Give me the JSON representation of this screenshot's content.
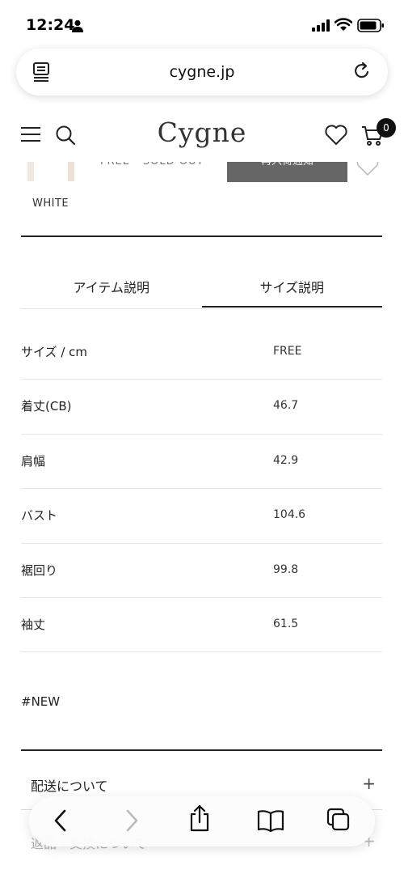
{
  "status_bar": {
    "time": "12:24"
  },
  "browser": {
    "url": "cygne.jp"
  },
  "site_header": {
    "logo": "Cygne",
    "cart_count": "0"
  },
  "product_row": {
    "size_text": "FREE - SOLD OUT",
    "notify_button": "再入荷通知",
    "color": "WHITE"
  },
  "tabs": [
    {
      "label": "アイテム説明"
    },
    {
      "label": "サイズ説明"
    }
  ],
  "size_table": {
    "rows": [
      {
        "key": "サイズ / cm",
        "value": "FREE"
      },
      {
        "key": "着丈(CB)",
        "value": "46.7"
      },
      {
        "key": "肩幅",
        "value": "42.9"
      },
      {
        "key": "バスト",
        "value": "104.6"
      },
      {
        "key": "裾回り",
        "value": "99.8"
      },
      {
        "key": "袖丈",
        "value": "61.5"
      }
    ]
  },
  "hashtag": "#NEW",
  "accordions": [
    {
      "label": "配送について",
      "icon": "plus-icon"
    },
    {
      "label": "返品・交換について",
      "icon": "plus-icon"
    }
  ],
  "icons": {
    "status": [
      "person-icon",
      "signal-icon",
      "wifi-icon",
      "battery-icon"
    ],
    "url_bar": [
      "reader-icon",
      "reload-icon"
    ],
    "header": [
      "menu-icon",
      "search-icon",
      "heart-icon",
      "cart-icon"
    ],
    "toolbar": [
      "back-icon",
      "forward-icon",
      "share-icon",
      "bookmarks-icon",
      "tabs-icon"
    ]
  }
}
